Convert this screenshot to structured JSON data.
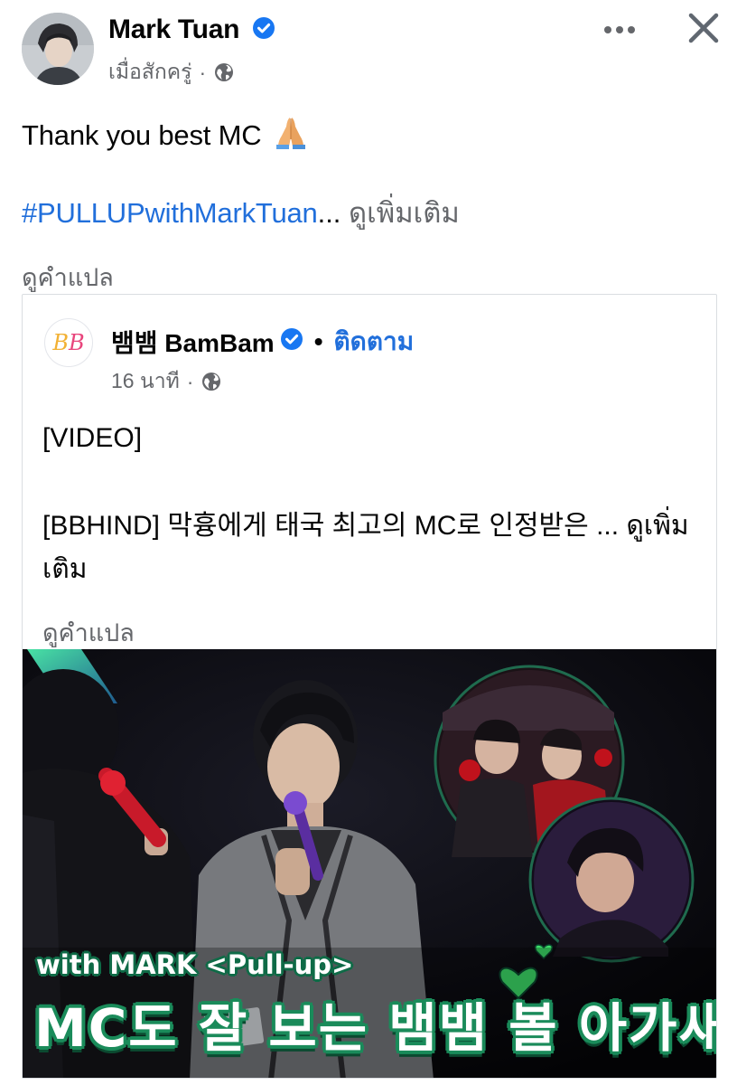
{
  "post": {
    "author": "Mark Tuan",
    "time": "เมื่อสักครู่",
    "dot": "·",
    "text": "Thank you best MC",
    "hashtag": "#PULLUPwithMarkTuan",
    "ellipsis": "...",
    "see_more": "ดูเพิ่มเติม",
    "see_translation": "ดูคำแปล",
    "privacy_icon": "globe-icon",
    "emoji": "folded-hands"
  },
  "shared": {
    "logo_text": "BB",
    "author": "뱀뱀 BamBam",
    "dot": "•",
    "follow": "ติดตาม",
    "time": "16 นาที",
    "meta_dot": "·",
    "line1": "[VIDEO]",
    "line2": "[BBHIND] 막흉에게 태국 최고의 MC로 인정받은 ... ดูเพิ่ม",
    "line3": "เติม",
    "see_translation": "ดูคำแปล"
  },
  "video": {
    "overlay_line1": "with MARK <Pull-up>",
    "overlay_line2": "MC도 잘 보는 뱀뱀 볼 아가새"
  },
  "colors": {
    "link_blue": "#216fdb",
    "verified_blue": "#1877f2",
    "secondary_text": "#65676b",
    "overlay_green": "#1a8b5a"
  },
  "icons": [
    "verified-badge-icon",
    "globe-icon",
    "more-icon",
    "close-icon",
    "heart-icon"
  ]
}
